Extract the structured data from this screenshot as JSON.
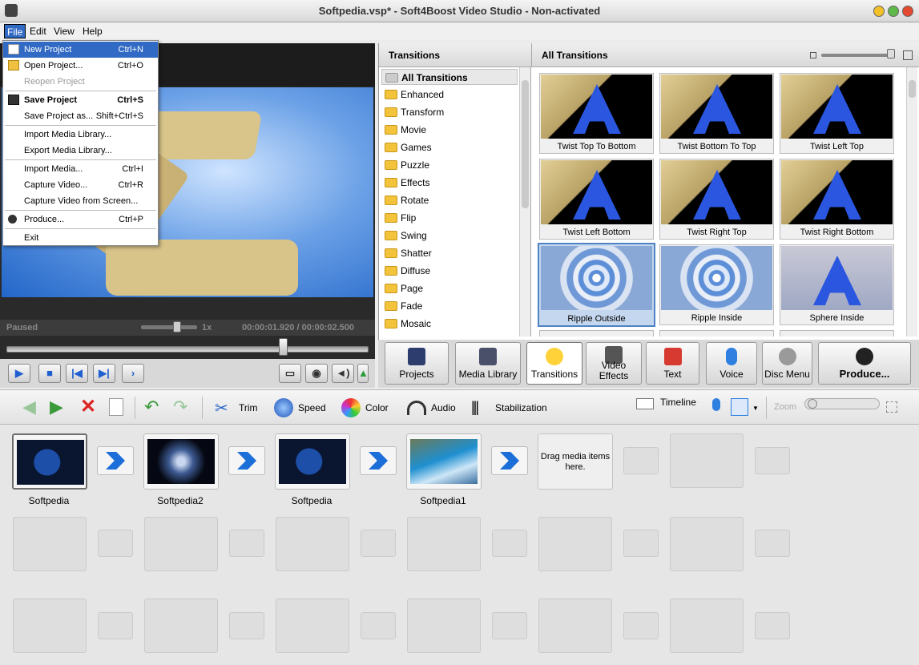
{
  "window": {
    "title": "Softpedia.vsp* - Soft4Boost Video Studio - Non-activated"
  },
  "menubar": {
    "items": [
      "File",
      "Edit",
      "View",
      "Help"
    ]
  },
  "file_menu": {
    "items": [
      {
        "label": "New Project",
        "shortcut": "Ctrl+N"
      },
      {
        "label": "Open Project...",
        "shortcut": "Ctrl+O"
      },
      {
        "label": "Reopen Project",
        "shortcut": ""
      },
      {
        "label": "Save Project",
        "shortcut": "Ctrl+S"
      },
      {
        "label": "Save Project as...",
        "shortcut": "Shift+Ctrl+S"
      },
      {
        "label": "Import Media Library...",
        "shortcut": ""
      },
      {
        "label": "Export Media Library...",
        "shortcut": ""
      },
      {
        "label": "Import Media...",
        "shortcut": "Ctrl+I"
      },
      {
        "label": "Capture Video...",
        "shortcut": "Ctrl+R"
      },
      {
        "label": "Capture Video from Screen...",
        "shortcut": ""
      },
      {
        "label": "Produce...",
        "shortcut": "Ctrl+P"
      },
      {
        "label": "Exit",
        "shortcut": ""
      }
    ]
  },
  "preview": {
    "status": "Paused",
    "speed": "1x",
    "time": "00:00:01.920 / 00:00:02.500"
  },
  "transitions_panel": {
    "left_title": "Transitions",
    "right_title": "All Transitions",
    "categories": [
      "All Transitions",
      "Enhanced",
      "Transform",
      "Movie",
      "Games",
      "Puzzle",
      "Effects",
      "Rotate",
      "Flip",
      "Swing",
      "Shatter",
      "Diffuse",
      "Page",
      "Fade",
      "Mosaic"
    ],
    "selected_category": "All Transitions",
    "tiles": [
      "Twist Top To Bottom",
      "Twist Bottom To Top",
      "Twist Left Top",
      "Twist Left Bottom",
      "Twist Right Top",
      "Twist Right Bottom",
      "Ripple Outside",
      "Ripple Inside",
      "Sphere Inside"
    ],
    "selected_tile": "Ripple Outside"
  },
  "tabs": {
    "items": [
      "Projects",
      "Media Library",
      "Transitions",
      "Video\nEffects",
      "Text",
      "Voice",
      "Disc Menu",
      "Produce..."
    ],
    "active": "Transitions"
  },
  "edit_toolbar": {
    "trim": "Trim",
    "speed": "Speed",
    "color": "Color",
    "audio": "Audio",
    "stabilization": "Stabilization",
    "timeline": "Timeline",
    "zoom": "Zoom"
  },
  "storyboard": {
    "clips": [
      "Softpedia",
      "Softpedia2",
      "Softpedia",
      "Softpedia1"
    ],
    "drag_hint": "Drag media items here."
  },
  "colors": {
    "accent": "#316ac5",
    "transition_arrow": "#1c6fd8"
  }
}
